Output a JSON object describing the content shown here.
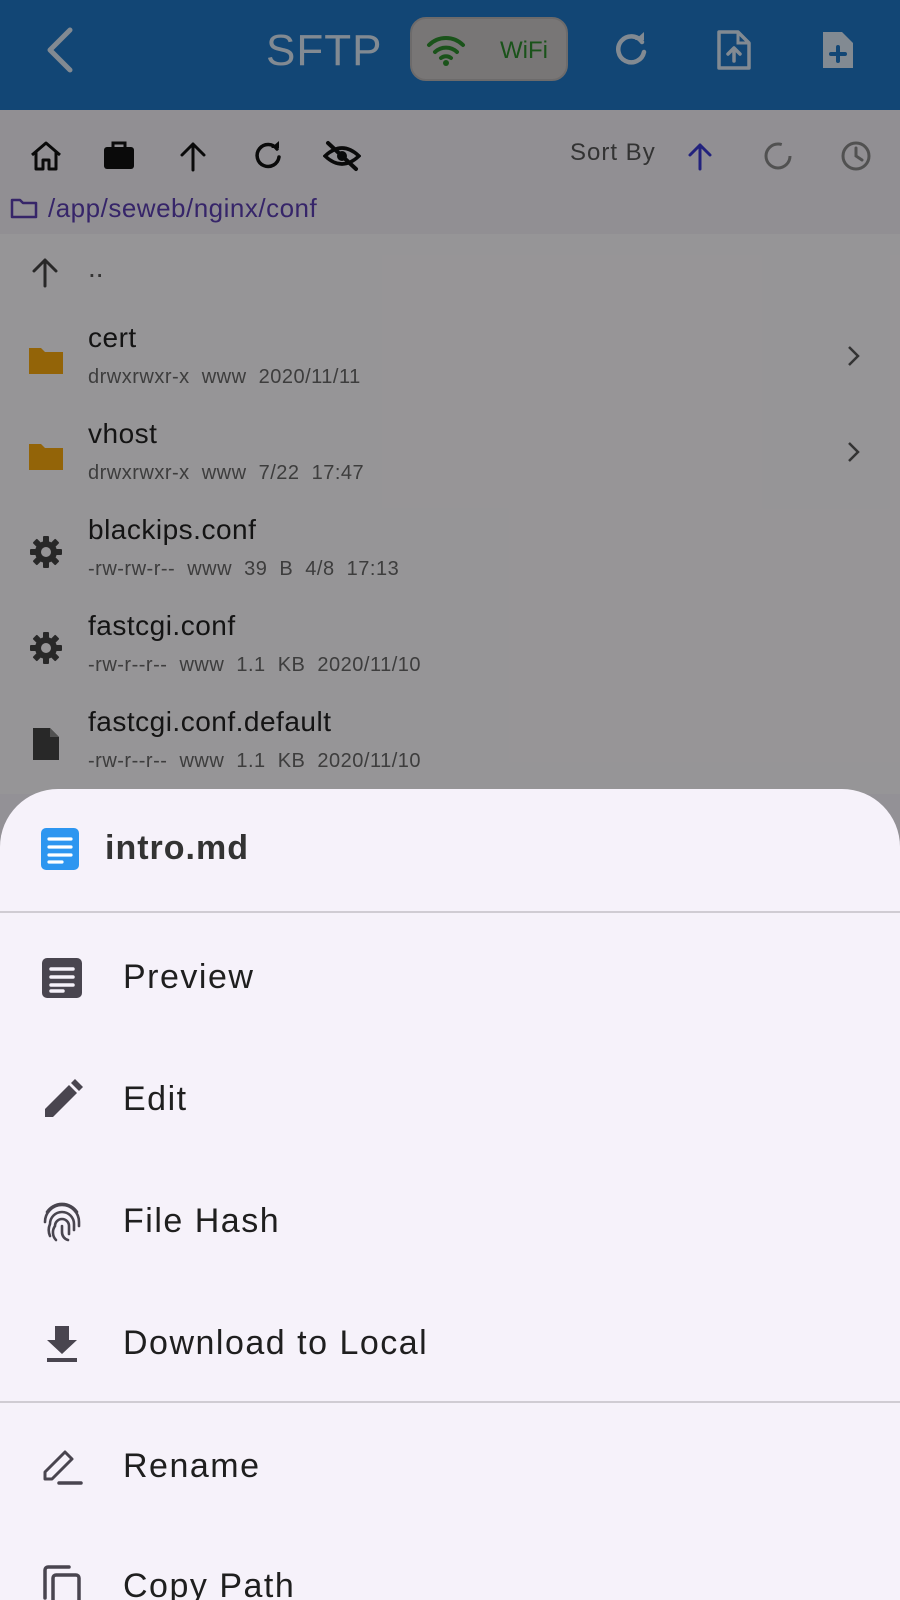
{
  "appbar": {
    "title": "SFTP",
    "network_label": "WiFi"
  },
  "toolbar": {
    "sort_label": "Sort By",
    "path": "/app/seweb/nginx/conf"
  },
  "filelist": {
    "up_label": "..",
    "items": [
      {
        "name": "cert",
        "meta": "drwxrwxr-x www 2020/11/11",
        "icon": "folder-icon"
      },
      {
        "name": "vhost",
        "meta": "drwxrwxr-x www 7/22 17:47",
        "icon": "folder-icon"
      },
      {
        "name": "blackips.conf",
        "meta": "-rw-rw-r-- www 39 B 4/8 17:13",
        "icon": "gear-icon"
      },
      {
        "name": "fastcgi.conf",
        "meta": "-rw-r--r-- www 1.1 KB 2020/11/10",
        "icon": "gear-icon"
      },
      {
        "name": "fastcgi.conf.default",
        "meta": "-rw-r--r-- www 1.1 KB 2020/11/10",
        "icon": "file-icon"
      }
    ]
  },
  "sheet": {
    "title": "intro.md",
    "items": [
      {
        "label": "Preview",
        "icon": "article-icon"
      },
      {
        "label": "Edit",
        "icon": "pencil-icon"
      },
      {
        "label": "File Hash",
        "icon": "fingerprint-icon"
      },
      {
        "label": "Download to Local",
        "icon": "download-icon"
      },
      {
        "label": "Rename",
        "icon": "rename-icon"
      },
      {
        "label": "Copy Path",
        "icon": "copy-icon"
      }
    ]
  },
  "colors": {
    "appbar": "#1f76c4",
    "path": "#5b3fb0",
    "folder": "#f5a70e",
    "wifi": "#2c8a2c",
    "doc_icon": "#2d96f0"
  }
}
